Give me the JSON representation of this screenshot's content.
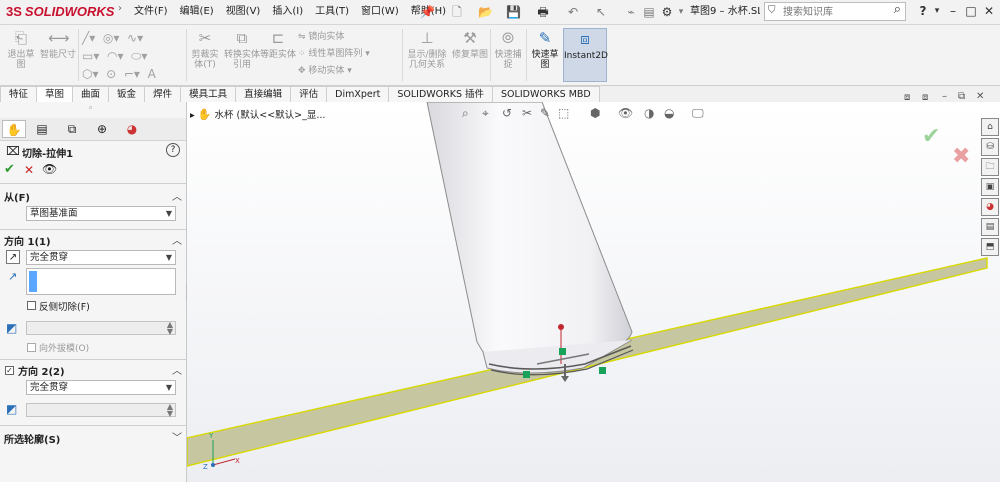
{
  "titlebar": {
    "logo_text": "SOLIDWORKS",
    "logo_mark": "3S",
    "menus": [
      "文件(F)",
      "编辑(E)",
      "视图(V)",
      "插入(I)",
      "工具(T)",
      "窗口(W)",
      "帮助(H)"
    ],
    "doc_title": "草图9 – 水杯.SL...",
    "search_placeholder": "搜索知识库",
    "help_label": "?",
    "window_controls": [
      "–",
      "□",
      "✕"
    ]
  },
  "ribbon": {
    "buttons_large": [
      {
        "label": "退出草图",
        "icon": "exit-sketch-icon"
      },
      {
        "label": "智能尺寸",
        "icon": "smart-dimension-icon"
      },
      {
        "label": "剪裁实体(T)",
        "icon": "trim-icon"
      },
      {
        "label": "转换实体引用",
        "icon": "convert-entities-icon"
      },
      {
        "label": "等距实体",
        "icon": "offset-icon"
      },
      {
        "label": "显示/删除几何关系",
        "icon": "relations-icon"
      },
      {
        "label": "修复草图",
        "icon": "repair-sketch-icon"
      },
      {
        "label": "快速捕捉",
        "icon": "quick-snap-icon"
      },
      {
        "label": "快速草图",
        "icon": "rapid-sketch-icon"
      },
      {
        "label": "Instant2D",
        "icon": "instant2d-icon"
      }
    ],
    "small_items": [
      "镜向实体",
      "线性草图阵列",
      "移动实体"
    ]
  },
  "tabs": [
    "特征",
    "草图",
    "曲面",
    "钣金",
    "焊件",
    "模具工具",
    "直接编辑",
    "评估",
    "DimXpert",
    "SOLIDWORKS 插件",
    "SOLIDWORKS MBD"
  ],
  "active_tab": "草图",
  "panel": {
    "feature_title": "切除-拉伸1",
    "help": "?",
    "from_label": "从(F)",
    "from_value": "草图基准面",
    "dir1_label": "方向 1(1)",
    "dir1_end": "完全贯穿",
    "flip_side_label": "反侧切除(F)",
    "draft_label": "向外拔模(O)",
    "dir2_label": "方向 2(2)",
    "dir2_end": "完全贯穿",
    "contours_label": "所选轮廓(S)"
  },
  "graphics": {
    "breadcrumb": "水杯  (默认<<默认>_显...",
    "colors": {
      "plane_fill": "#c9c9a3",
      "plane_edge": "#d4d400",
      "cylinder": "#f4f4f6",
      "cylinder_edge": "#8c8c8c"
    }
  }
}
